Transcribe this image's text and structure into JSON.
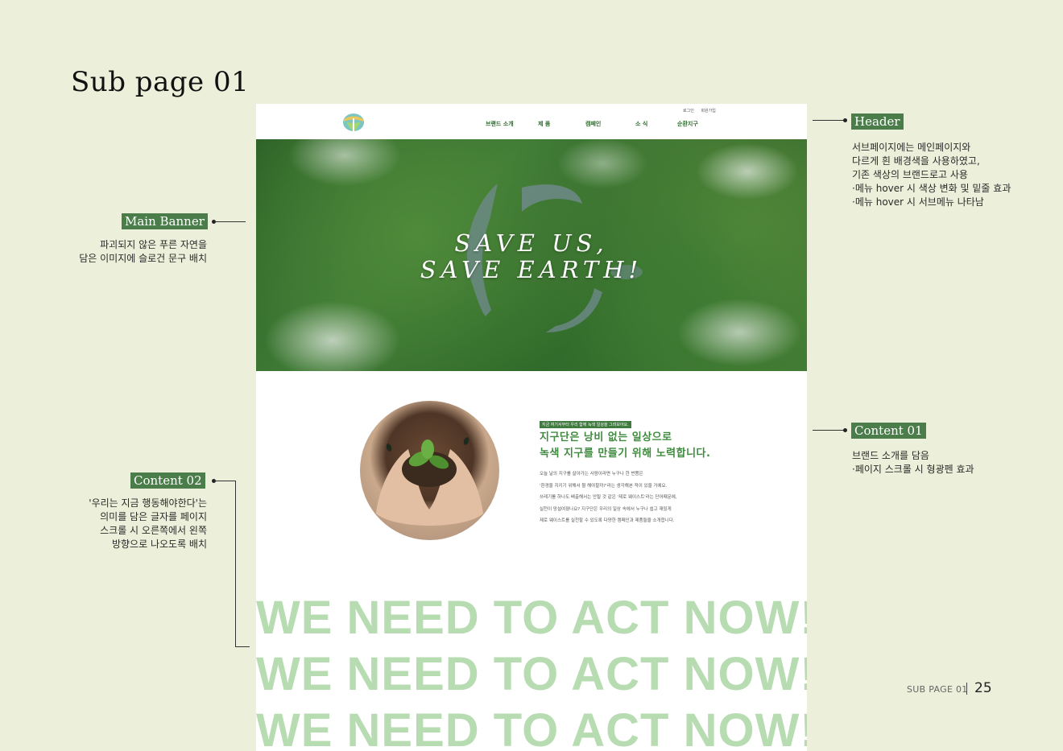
{
  "page_title": "Sub page 01",
  "annotations": {
    "header": {
      "label": "Header",
      "note": "서브페이지에는 메인페이지와\n다르게 흰 배경색을 사용하였고,\n기존 색상의 브랜드로고 사용\n·메뉴 hover 시 색상 변화 및 밑줄 효과\n·메뉴 hover 시 서브메뉴 나타남"
    },
    "main_banner": {
      "label": "Main Banner",
      "note": "파괴되지 않은 푸른 자연을\n담은 이미지에 슬로건 문구 배치"
    },
    "content01": {
      "label": "Content 01",
      "note": "브랜드 소개를 담음\n·페이지 스크롤 시 형광펜 효과"
    },
    "content02": {
      "label": "Content 02",
      "note": "'우리는 지금 행동해야한다'는\n의미를 담은 글자를 페이지\n스크롤 시 오른쪽에서 왼쪽\n방향으로 나오도록 배치"
    }
  },
  "mockup": {
    "header": {
      "util_login": "로그인",
      "util_join": "회원가입",
      "nav": [
        "브랜드 소개",
        "제 품",
        "캠페인",
        "소 식",
        "순환지구"
      ],
      "logo_icon": "leaf-circle-logo-icon"
    },
    "banner": {
      "slogan_line1": "SAVE US,",
      "slogan_line2": "SAVE EARTH!"
    },
    "content": {
      "badge": "지금 여기서부터 우리 함께 녹색 일상을 그려보아요.",
      "heading": "지구단은 낭비 없는 일상으로\n녹색 지구를 만들기 위해 노력합니다.",
      "body": "오늘 날의 지구를 살아가는 사람이라면 누구나 한 번쯤은\n'환경을 지키기 위해서 뭘 해야할까?'라는 생각해본 적이 있을 거예요.\n쓰레기를 하나도 배출해서는 안될 것 같은 '제로 웨이스트'라는 단어때문에,\n실천이 망설여졌나요? 지구단은 우리의 일상 속에서 누구나 쉽고 재밌게\n제로 웨이스트를 실천할 수 있도록 다양한 캠페인과 제품들을 소개합니다."
    },
    "marquee": [
      "WE NEED TO ACT NOW!",
      "WE NEED TO ACT NOW!",
      "WE NEED TO ACT NOW!"
    ]
  },
  "footer": {
    "label": "SUB PAGE 01",
    "page_number": "25"
  },
  "colors": {
    "background": "#ecefd9",
    "tag_green": "#4b7d4b",
    "nav_green": "#2e6b2e",
    "heading_green": "#3f8a3f",
    "marquee_green": "#b8dcb2"
  }
}
